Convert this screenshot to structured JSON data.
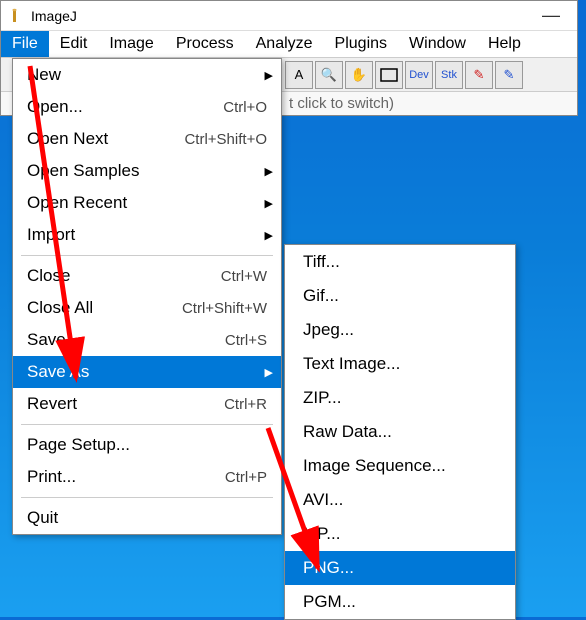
{
  "titlebar": {
    "title": "ImageJ"
  },
  "menubar": {
    "items": [
      "File",
      "Edit",
      "Image",
      "Process",
      "Analyze",
      "Plugins",
      "Window",
      "Help"
    ]
  },
  "toolbar": {
    "buttons": [
      "A",
      "🔍",
      "✋",
      "▭",
      "Dev",
      "Stk",
      "✎",
      "✎"
    ]
  },
  "status": {
    "text": "t click to switch)"
  },
  "file_menu": {
    "items": [
      {
        "label": "New",
        "shortcut": "",
        "arrow": true
      },
      {
        "label": "Open...",
        "shortcut": "Ctrl+O"
      },
      {
        "label": "Open Next",
        "shortcut": "Ctrl+Shift+O"
      },
      {
        "label": "Open Samples",
        "shortcut": "",
        "arrow": true
      },
      {
        "label": "Open Recent",
        "shortcut": "",
        "arrow": true
      },
      {
        "label": "Import",
        "shortcut": "",
        "arrow": true
      },
      {
        "label": "Close",
        "shortcut": "Ctrl+W"
      },
      {
        "label": "Close All",
        "shortcut": "Ctrl+Shift+W"
      },
      {
        "label": "Save",
        "shortcut": "Ctrl+S"
      },
      {
        "label": "Save As",
        "shortcut": "",
        "arrow": true,
        "highlight": true
      },
      {
        "label": "Revert",
        "shortcut": "Ctrl+R"
      },
      {
        "label": "Page Setup...",
        "shortcut": ""
      },
      {
        "label": "Print...",
        "shortcut": "Ctrl+P"
      },
      {
        "label": "Quit",
        "shortcut": ""
      }
    ]
  },
  "saveas_menu": {
    "items": [
      {
        "label": "Tiff..."
      },
      {
        "label": "Gif..."
      },
      {
        "label": "Jpeg..."
      },
      {
        "label": "Text Image..."
      },
      {
        "label": "ZIP..."
      },
      {
        "label": "Raw Data..."
      },
      {
        "label": "Image Sequence..."
      },
      {
        "label": "AVI..."
      },
      {
        "label": "MP..."
      },
      {
        "label": "PNG...",
        "highlight": true
      },
      {
        "label": "PGM..."
      }
    ]
  },
  "annotation": {
    "arrow_color": "#ff0000"
  }
}
